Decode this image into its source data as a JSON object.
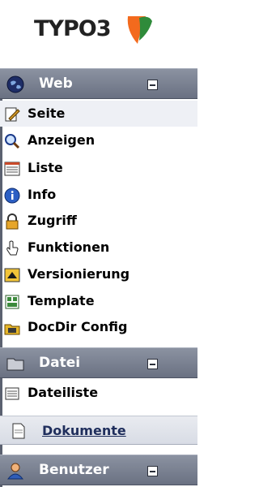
{
  "logo": {
    "text": "TYPO3",
    "icon": "typo3-logo-icon"
  },
  "modules": [
    {
      "title": "Web",
      "icon": "globe-icon",
      "items": [
        {
          "label": "Seite",
          "icon": "page-edit-icon",
          "active": true
        },
        {
          "label": "Anzeigen",
          "icon": "magnifier-icon"
        },
        {
          "label": "Liste",
          "icon": "list-icon"
        },
        {
          "label": "Info",
          "icon": "info-icon"
        },
        {
          "label": "Zugriff",
          "icon": "lock-icon"
        },
        {
          "label": "Funktionen",
          "icon": "hand-pointer-icon"
        },
        {
          "label": "Versionierung",
          "icon": "versioning-icon"
        },
        {
          "label": "Template",
          "icon": "template-icon"
        },
        {
          "label": "DocDir Config",
          "icon": "config-icon"
        }
      ]
    },
    {
      "title": "Datei",
      "icon": "folder-icon",
      "items": [
        {
          "label": "Dateiliste",
          "icon": "file-list-icon"
        }
      ]
    }
  ],
  "documents": {
    "label": "Dokumente",
    "icon": "document-icon"
  },
  "user_module": {
    "title": "Benutzer",
    "icon": "user-icon"
  }
}
